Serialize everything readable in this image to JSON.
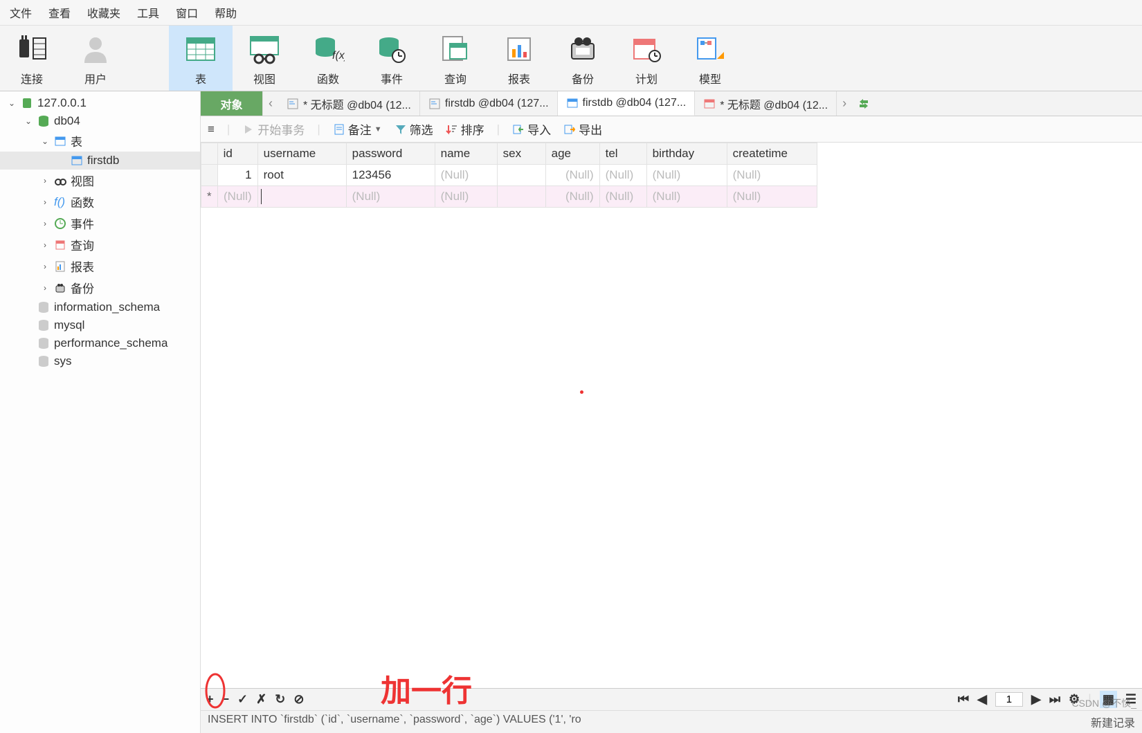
{
  "menu": {
    "file": "文件",
    "view": "查看",
    "fav": "收藏夹",
    "tools": "工具",
    "window": "窗口",
    "help": "帮助"
  },
  "toolbar": {
    "connect": "连接",
    "user": "用户",
    "table": "表",
    "view": "视图",
    "function": "函数",
    "event": "事件",
    "query": "查询",
    "report": "报表",
    "backup": "备份",
    "schedule": "计划",
    "model": "模型"
  },
  "tree": {
    "server": "127.0.0.1",
    "db": "db04",
    "tables": "表",
    "table1": "firstdb",
    "views": "视图",
    "functions": "函数",
    "events": "事件",
    "queries": "查询",
    "reports": "报表",
    "backups": "备份",
    "sys_dbs": [
      "information_schema",
      "mysql",
      "performance_schema",
      "sys"
    ]
  },
  "tabs": {
    "object": "对象",
    "t1": "* 无标题 @db04 (12...",
    "t2": "firstdb @db04 (127...",
    "t3": "firstdb @db04 (127...",
    "t4": "* 无标题 @db04 (12..."
  },
  "subbar": {
    "begin": "开始事务",
    "memo": "备注",
    "filter": "筛选",
    "sort": "排序",
    "import": "导入",
    "export": "导出"
  },
  "columns": {
    "id": "id",
    "username": "username",
    "password": "password",
    "name": "name",
    "sex": "sex",
    "age": "age",
    "tel": "tel",
    "birthday": "birthday",
    "createtime": "createtime"
  },
  "rows": [
    {
      "marker": "",
      "id": "1",
      "username": "root",
      "password": "123456",
      "name": "(Null)",
      "sex": "",
      "age": "(Null)",
      "tel": "(Null)",
      "birthday": "(Null)",
      "createtime": "(Null)"
    },
    {
      "marker": "*",
      "id": "(Null)",
      "username": "",
      "password": "(Null)",
      "name": "(Null)",
      "sex": "",
      "age": "(Null)",
      "tel": "(Null)",
      "birthday": "(Null)",
      "createtime": "(Null)"
    }
  ],
  "footer": {
    "page": "1"
  },
  "status": {
    "sql": "INSERT INTO `firstdb` (`id`, `username`, `password`, `age`) VALUES ('1', 'ro",
    "msg": "新建记录"
  },
  "annotation": "加一行",
  "watermark": "CSDN @不惔_"
}
